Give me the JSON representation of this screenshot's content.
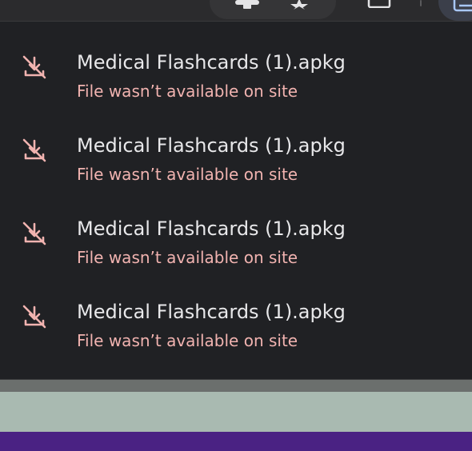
{
  "toolbar": {
    "icons": [
      "extension-icon",
      "bookmark-star-icon",
      "window-icon",
      "downloads-icon"
    ]
  },
  "downloads": {
    "items": [
      {
        "name": "Medical Flashcards (1).apkg",
        "status": "File wasn’t available on site",
        "icon": "download-off-icon"
      },
      {
        "name": "Medical Flashcards (1).apkg",
        "status": "File wasn’t available on site",
        "icon": "download-off-icon"
      },
      {
        "name": "Medical Flashcards (1).apkg",
        "status": "File wasn’t available on site",
        "icon": "download-off-icon"
      },
      {
        "name": "Medical Flashcards (1).apkg",
        "status": "File wasn’t available on site",
        "icon": "download-off-icon"
      }
    ]
  },
  "colors": {
    "panel_bg": "#202124",
    "title_text": "#e8e8ea",
    "error_text": "#f1b3b0",
    "page_green": "#a9bab1",
    "page_purple": "#4a2283"
  }
}
